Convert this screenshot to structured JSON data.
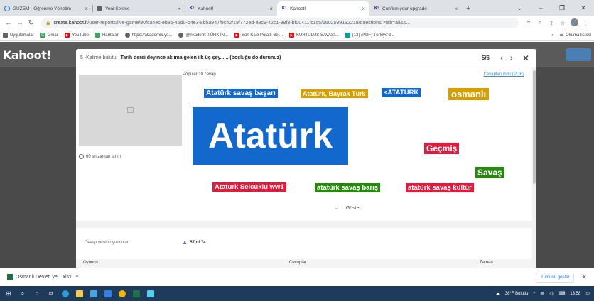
{
  "browser": {
    "tabs": [
      {
        "title": "GUZEM - Öğrenme Yönetim",
        "icon": "guzem-icon",
        "active": false
      },
      {
        "title": "Yeni Sekme",
        "icon": "chrome-icon",
        "active": false
      },
      {
        "title": "Kahoot!",
        "icon": "kahoot-icon",
        "active": false
      },
      {
        "title": "Kahoot!",
        "icon": "kahoot-icon",
        "active": true
      },
      {
        "title": "Confirm your upgrade",
        "icon": "kahoot-icon",
        "active": false
      }
    ],
    "url_host": "create.kahoot.it",
    "url_path": "/user-reports/live-game/90fca4ec-eb86-45d0-b4e3-8b5a947f9c42/19f772ed-a8c9-42c1-99f3-bf00411fc1c5/1602599132218/questions/?tab=all&s...",
    "bookmarks": [
      {
        "label": "Uygulamalar",
        "color": "#5f6368"
      },
      {
        "label": "Gmail",
        "color": "#ea4335"
      },
      {
        "label": "YouTube",
        "color": "#ff0000"
      },
      {
        "label": "Haritalar",
        "color": "#34a853"
      },
      {
        "label": "https://akademik.yo...",
        "color": "#5f6368"
      },
      {
        "label": "@nkadem: TÜRK İN...",
        "color": "#5f6368"
      },
      {
        "label": "Son Kale Polatlı Bel...",
        "color": "#ff0000"
      },
      {
        "label": "KURTULUŞ SAVAŞI...",
        "color": "#ff0000"
      },
      {
        "label": "(13) (PDF) Türkiye'd...",
        "color": "#00a0a0"
      }
    ],
    "reading_list": "Okuma listesi"
  },
  "kahoot": {
    "logo": "Kahoot!",
    "modal": {
      "question_label": "5 -Kelime bulutu",
      "question_title": "Tarih dersi deyince aklıma gelen ilk üç şey...... (boşluğu doldurunuz)",
      "pager": "5/6",
      "popular_label": "Popüler 10 cevap",
      "download_label": "Cevapları indir (PDF)",
      "timer_label": "60 sn zaman sınırı",
      "words": [
        {
          "text": "Atatürk savaş başarı",
          "color": "#1368ce"
        },
        {
          "text": "Atatürk, Bayrak Türk",
          "color": "#d89e00"
        },
        {
          "text": "<ATATÜRK",
          "color": "#1368ce"
        },
        {
          "text": "osmanlı",
          "color": "#d89e00"
        },
        {
          "text": "Atatürk",
          "color": "#1368ce"
        },
        {
          "text": "Geçmiş",
          "color": "#e21b3c"
        },
        {
          "text": "Savaş",
          "color": "#26890c"
        },
        {
          "text": "Ataturk Selcuklu ww1",
          "color": "#e21b3c"
        },
        {
          "text": "atatürk savaş barış",
          "color": "#26890c"
        },
        {
          "text": "atatürk savaş kültür",
          "color": "#e21b3c"
        }
      ],
      "show_label": "Göster",
      "players_label": "Cevap veren oyuncular",
      "players_count": "57 of 74",
      "table_headers": [
        "Oyuncu",
        "Cevaplar",
        "Zaman"
      ]
    }
  },
  "downloads": {
    "file": "Osmanlı Devleti ye....xlsx",
    "show_all": "Tümünü göster"
  },
  "taskbar": {
    "weather": "38°F Bulutlu",
    "time": "13:58"
  }
}
